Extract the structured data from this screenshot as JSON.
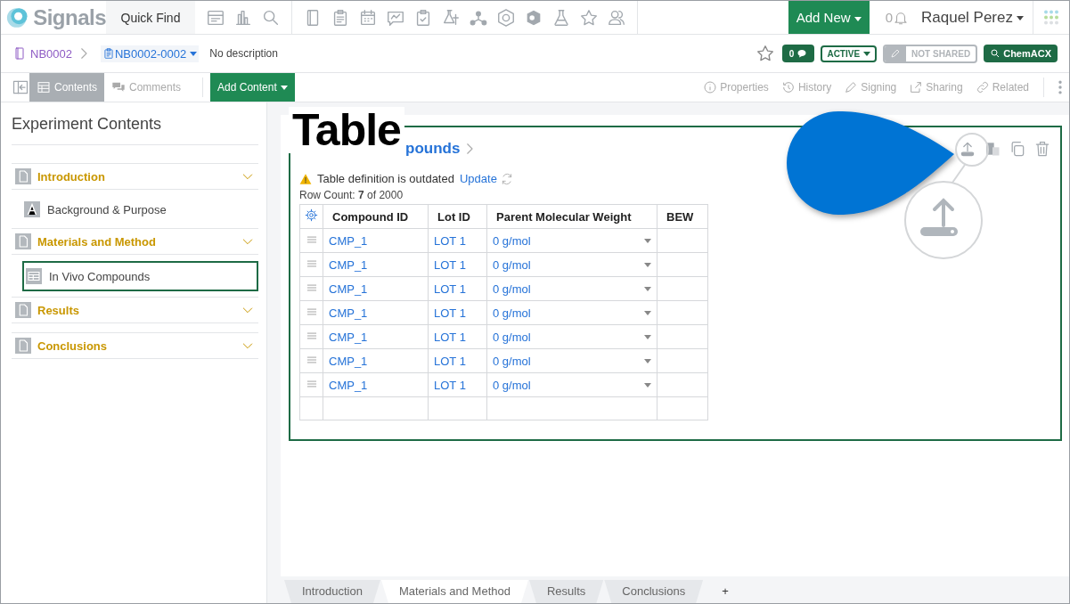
{
  "top_nav": {
    "logo": "Signals",
    "quick_find": "Quick Find",
    "add_new": "Add New",
    "notification_count": "0",
    "user": "Raquel Perez"
  },
  "breadcrumb": {
    "notebook": "NB0002",
    "experiment": "NB0002-0002",
    "description": "No description"
  },
  "status": {
    "comment_count": "0",
    "state": "ACTIVE",
    "sharing": "NOT SHARED",
    "search_button": "ChemACX"
  },
  "toolbar": {
    "tabs": [
      {
        "label": "Contents",
        "selected": true
      },
      {
        "label": "Comments",
        "selected": false
      }
    ],
    "add_content": "Add Content",
    "actions": [
      {
        "kind": "info",
        "label": "Properties"
      },
      {
        "kind": "history",
        "label": "History"
      },
      {
        "kind": "pen",
        "label": "Signing"
      },
      {
        "kind": "share",
        "label": "Sharing"
      },
      {
        "kind": "link",
        "label": "Related"
      }
    ]
  },
  "sidebar": {
    "title": "Experiment Contents",
    "sections": [
      {
        "label": "Introduction",
        "children": [
          {
            "kind": "text",
            "label": "Background & Purpose",
            "selected": false
          }
        ]
      },
      {
        "label": "Materials and Method",
        "children": [
          {
            "kind": "table",
            "label": "In Vivo Compounds",
            "selected": true
          }
        ]
      },
      {
        "label": "Results"
      },
      {
        "label": "Conclusions"
      }
    ]
  },
  "callout": {
    "label": "Table"
  },
  "card": {
    "title": "pounds",
    "warning": "Table definition is outdated",
    "update_link": "Update",
    "row_count": "Row Count: **7** of 2000",
    "table": {
      "columns": [
        "Compound ID",
        "Lot ID",
        "Parent Molecular Weight",
        "BEW"
      ],
      "rows": [
        {
          "compound_id": "CMP_1",
          "lot_id": "LOT 1",
          "molecular_weight": "0 g/mol"
        },
        {
          "compound_id": "CMP_1",
          "lot_id": "LOT 1",
          "molecular_weight": "0 g/mol"
        },
        {
          "compound_id": "CMP_1",
          "lot_id": "LOT 1",
          "molecular_weight": "0 g/mol"
        },
        {
          "compound_id": "CMP_1",
          "lot_id": "LOT 1",
          "molecular_weight": "0 g/mol"
        },
        {
          "compound_id": "CMP_1",
          "lot_id": "LOT 1",
          "molecular_weight": "0 g/mol"
        },
        {
          "compound_id": "CMP_1",
          "lot_id": "LOT 1",
          "molecular_weight": "0 g/mol"
        },
        {
          "compound_id": "CMP_1",
          "lot_id": "LOT 1",
          "molecular_weight": "0 g/mol"
        }
      ]
    }
  },
  "bottom_tabs": [
    {
      "label": "Introduction",
      "selected": false
    },
    {
      "label": "Materials and Method",
      "selected": true
    },
    {
      "label": "Results",
      "selected": false
    },
    {
      "label": "Conclusions",
      "selected": false
    }
  ],
  "add_tab": "+"
}
